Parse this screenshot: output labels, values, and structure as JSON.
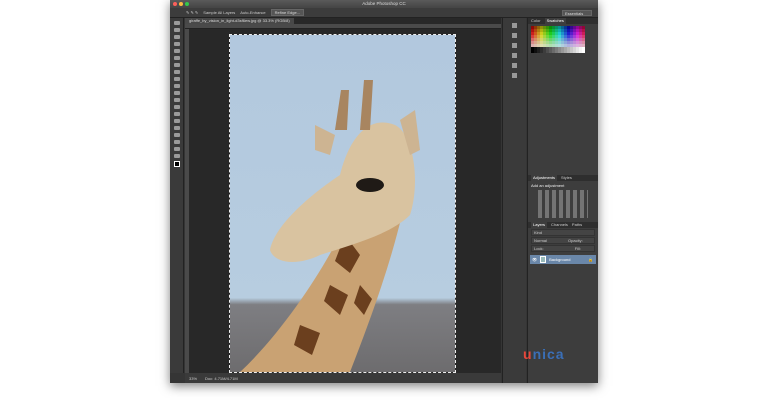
{
  "window": {
    "title": "Adobe Photoshop CC"
  },
  "options": {
    "sample_all_layers": "Sample All Layers",
    "auto_enhance": "Auto-Enhance",
    "refine_edge": "Refine Edge...",
    "workspace": "Essentials"
  },
  "document": {
    "tab": "giraffe_by_vision_in_light-d3sf6ew.jpg @ 33.3% (RGB/8)"
  },
  "status": {
    "zoom": "33%",
    "doc_info": "Doc: 4.71M/4.71M"
  },
  "panels": {
    "color_tabs": [
      "Color",
      "Swatches"
    ],
    "adjust_tabs": [
      "Adjustments",
      "Styles"
    ],
    "adjust_hint": "Add an adjustment",
    "layer_tabs": [
      "Layers",
      "Channels",
      "Paths"
    ],
    "kind": "Kind",
    "blend": "Normal",
    "opacity": "Opacity:",
    "lock": "Lock:",
    "fill": "Fill:",
    "layers": [
      {
        "name": "Background",
        "visible": true,
        "locked": true
      }
    ]
  },
  "watermark": "unica",
  "colors": {
    "accent": "#6a87a9",
    "watermark_red": "#e8473b",
    "watermark_blue": "#3a6fb7"
  }
}
